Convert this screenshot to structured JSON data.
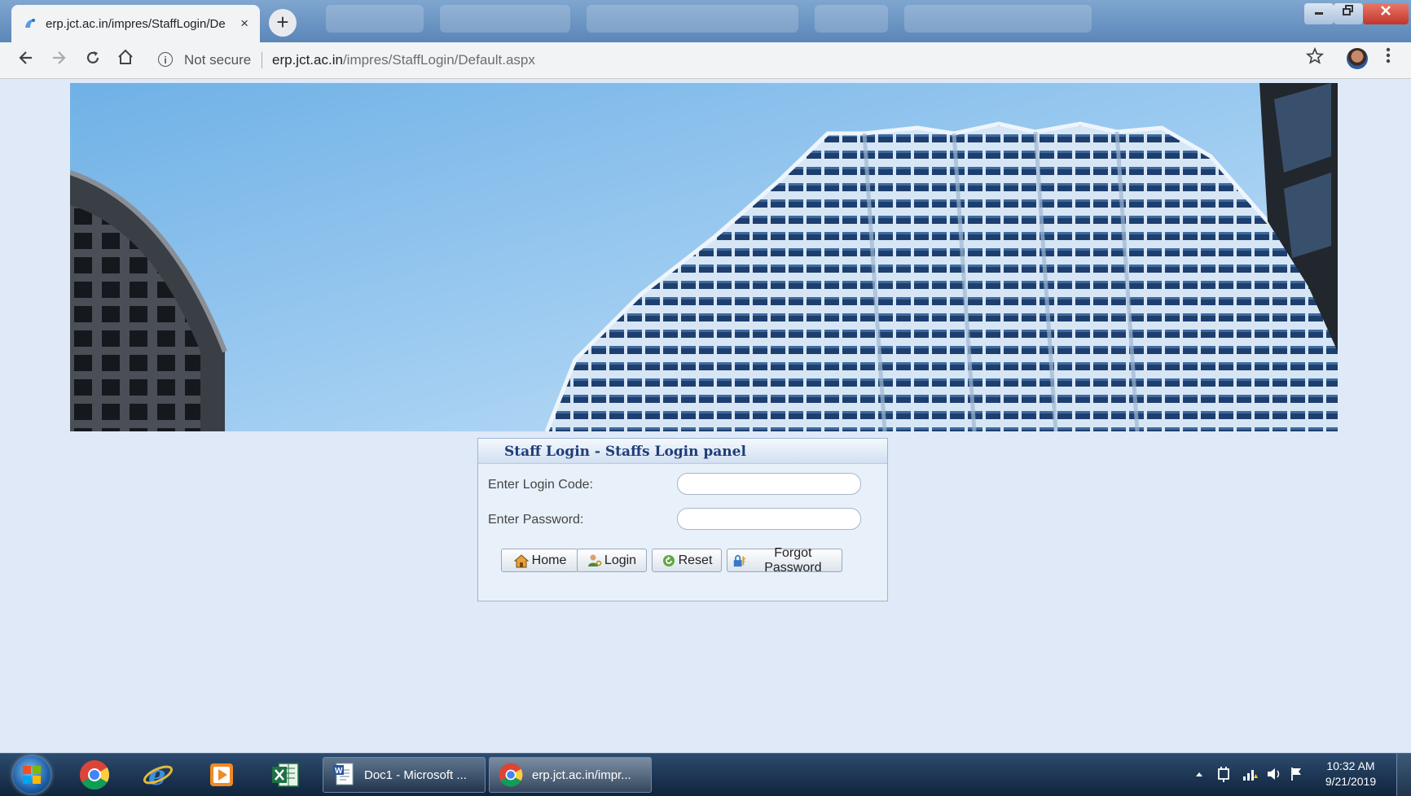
{
  "browser": {
    "tab_title": "erp.jct.ac.in/impres/StaffLogin/Default.aspx",
    "tab_close": "×",
    "new_tab": "+",
    "security_label": "Not secure",
    "url_host": "erp.jct.ac.in",
    "url_path": "/impres/StaffLogin/Default.aspx"
  },
  "login_panel": {
    "title": "Staff Login - Staffs Login panel",
    "login_code_label": "Enter Login Code:",
    "login_code_value": "",
    "password_label": "Enter Password:",
    "password_value": "",
    "buttons": {
      "home": "Home",
      "login": "Login",
      "reset": "Reset",
      "forgot_password": "Forgot Password"
    }
  },
  "taskbar": {
    "windows": [
      {
        "label": "Doc1 - Microsoft ..."
      },
      {
        "label": "erp.jct.ac.in/impr..."
      }
    ],
    "clock": {
      "time": "10:32 AM",
      "date": "9/21/2019"
    }
  },
  "colors": {
    "page_background": "#dfe9f7",
    "panel_title": "#1f3d7a",
    "taskbar": "#1b3452"
  }
}
